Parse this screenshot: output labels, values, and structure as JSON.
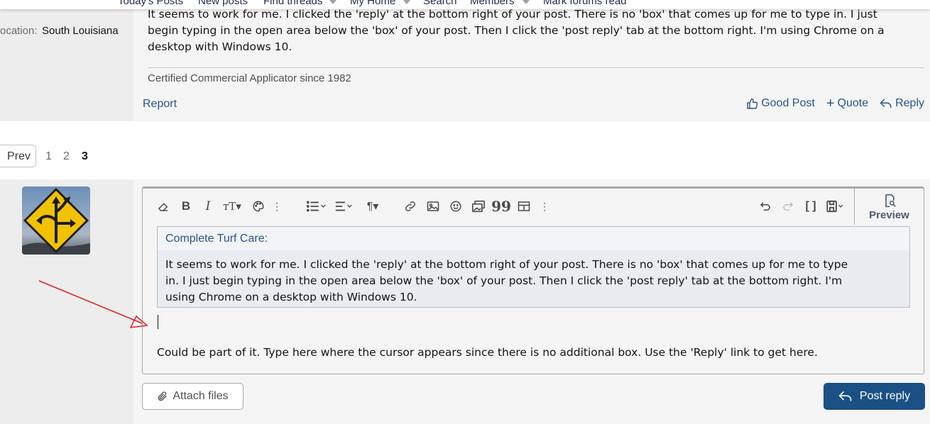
{
  "nav": {
    "items": [
      "Today's Posts",
      "New posts",
      "Find threads",
      "My Home",
      "Search",
      "Members",
      "Mark forums read"
    ]
  },
  "post": {
    "location_label": "ocation:",
    "location_value": "South Louisiana",
    "text_line1": "It seems to work for me. I clicked the 'reply' at the bottom right of your post. There is no 'box' that comes up for me to type in. I just",
    "text_line2": "begin typing in the open area below the 'box' of your post. Then I click the 'post reply' tab at the bottom right. I'm using Chrome on a",
    "text_line3": "desktop with Windows 10.",
    "signature": "Certified Commercial Applicator since 1982",
    "report": "Report",
    "good_post": "Good Post",
    "quote": "Quote",
    "reply": "Reply"
  },
  "pager": {
    "prev": "Prev",
    "pages": [
      "1",
      "2",
      "3"
    ],
    "current": "3"
  },
  "editor": {
    "preview": "Preview",
    "quote_author": "Complete Turf Care:",
    "quote_line1": "It seems to work for me.  I clicked the 'reply' at the bottom right of your post.  There is no 'box' that comes up for me to type",
    "quote_line2": "in. I just begin typing in the open area below the 'box' of your post.  Then I click the 'post reply' tab at the bottom right.  I'm",
    "quote_line3": "using Chrome on a desktop with Windows 10.",
    "new_text": "Could be part of it.  Type here where the cursor appears since there is no additional box.  Use the 'Reply' link to get here."
  },
  "buttons": {
    "attach": "Attach files",
    "post_reply": "Post reply"
  },
  "colors": {
    "accent": "#1a5084",
    "link": "#2a5585",
    "annotation_arrow": "#e02020"
  }
}
